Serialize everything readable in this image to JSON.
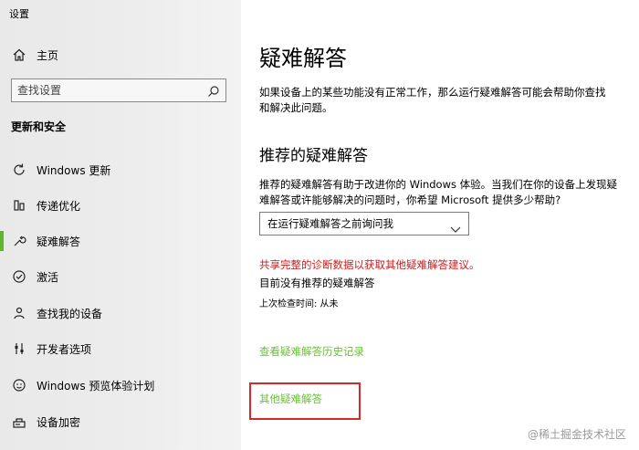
{
  "window": {
    "title": "设置"
  },
  "sidebar": {
    "home_label": "主页",
    "search": {
      "placeholder": "查找设置"
    },
    "section_header": "更新和安全",
    "items": [
      {
        "label": "Windows 更新",
        "icon": "refresh-icon",
        "active": false
      },
      {
        "label": "传递优化",
        "icon": "delivery-optimization-icon",
        "active": false
      },
      {
        "label": "疑难解答",
        "icon": "wrench-icon",
        "active": true
      },
      {
        "label": "激活",
        "icon": "check-circle-icon",
        "active": false
      },
      {
        "label": "查找我的设备",
        "icon": "person-locate-icon",
        "active": false
      },
      {
        "label": "开发者选项",
        "icon": "developer-tools-icon",
        "active": false
      },
      {
        "label": "Windows 预览体验计划",
        "icon": "smiley-icon",
        "active": false
      },
      {
        "label": "设备加密",
        "icon": "encryption-icon",
        "active": false
      }
    ]
  },
  "main": {
    "title": "疑难解答",
    "description": "如果设备上的某些功能没有正常工作，那么运行疑难解答可能会帮助你查找和解决此问题。",
    "recommended_heading": "推荐的疑难解答",
    "recommended_description": "推荐的疑难解答有助于改进你的 Windows 体验。当我们在你的设备上发现疑难解答或许能够解决的问题时，你希望 Microsoft 提供多少帮助?",
    "dropdown_value": "在运行疑难解答之前询问我",
    "share_link": "共享完整的诊断数据以获取其他疑难解答建议。",
    "no_recommended": "目前没有推荐的疑难解答",
    "last_checked": "上次检查时间: 从未",
    "history_link": "查看疑难解答历史记录",
    "other_link": "其他疑难解答"
  },
  "watermark": "@稀土掘金技术社区",
  "colors": {
    "accent": "#5eb82e",
    "link_green": "#6cbf3a",
    "warning_red": "#c81e1e",
    "highlight_border": "#d42a2a"
  }
}
